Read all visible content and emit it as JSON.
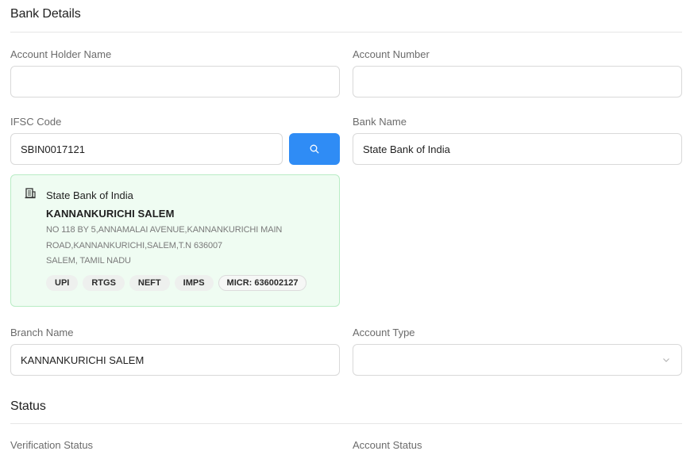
{
  "sections": {
    "bank_details_title": "Bank Details",
    "status_title": "Status"
  },
  "fields": {
    "account_holder_name": {
      "label": "Account Holder Name",
      "value": ""
    },
    "account_number": {
      "label": "Account Number",
      "value": ""
    },
    "ifsc_code": {
      "label": "IFSC Code",
      "value": "SBIN0017121"
    },
    "bank_name": {
      "label": "Bank Name",
      "value": "State Bank of India"
    },
    "branch_name": {
      "label": "Branch Name",
      "value": "KANNANKURICHI SALEM"
    },
    "account_type": {
      "label": "Account Type",
      "value": ""
    },
    "verification_status": {
      "label": "Verification Status"
    },
    "account_status": {
      "label": "Account Status"
    }
  },
  "ifsc_lookup": {
    "search_icon": "search-icon",
    "bank_icon": "bank-building-icon",
    "bank": "State Bank of India",
    "branch": "KANNANKURICHI SALEM",
    "address_line1": "NO 118 BY 5,ANNAMALAI AVENUE,KANNANKURICHI MAIN",
    "address_line2": "ROAD,KANNANKURICHI,SALEM,T.N 636007",
    "address_line3": "SALEM, TAMIL NADU",
    "badges": [
      "UPI",
      "RTGS",
      "NEFT",
      "IMPS"
    ],
    "micr": "MICR: 636002127"
  },
  "colors": {
    "accent": "#2f8cf5",
    "card_bg": "#effcf2",
    "card_border": "#b9ecc5"
  }
}
